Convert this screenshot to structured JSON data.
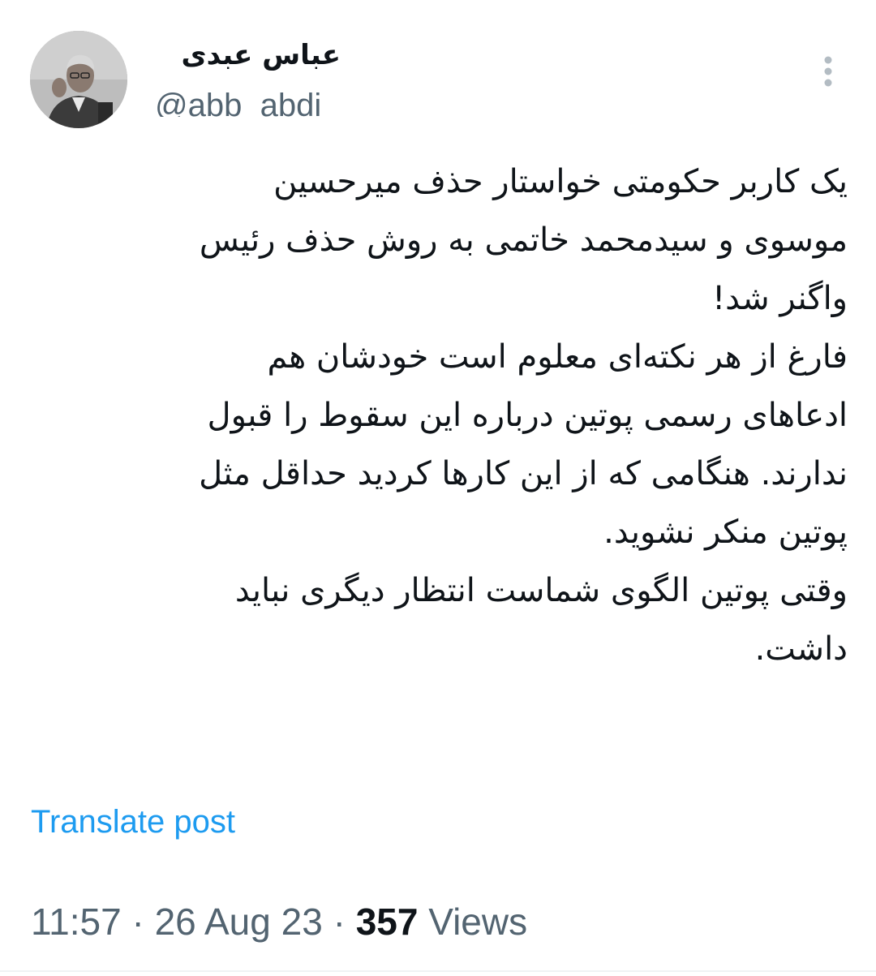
{
  "author": {
    "display_name": "عباس عبدی",
    "handle": "@abb_abdi"
  },
  "tweet": {
    "lines": [
      "یک کاربر حکومتی خواستار حذف میرحسین",
      "موسوی و سیدمحمد خاتمی به روش حذف رئیس",
      "واگنر شد!",
      "فارغ از هر نکته‌ای معلوم است خودشان هم",
      "ادعاهای رسمی پوتین درباره این سقوط را قبول",
      "ندارند. هنگامی که از این کارها کردید حداقل مثل",
      "پوتین منکر نشوید.",
      "وقتی پوتین الگوی شماست انتظار دیگری نباید",
      "داشت."
    ]
  },
  "translate_label": "Translate post",
  "meta": {
    "time": "11:57",
    "separator": "·",
    "date": "26 Aug 23",
    "views_count": "357",
    "views_label": "Views"
  },
  "icons": {
    "more": "more-vertical-icon"
  },
  "colors": {
    "text": "#0f1419",
    "secondary": "#536471",
    "link": "#1d9bf0"
  }
}
